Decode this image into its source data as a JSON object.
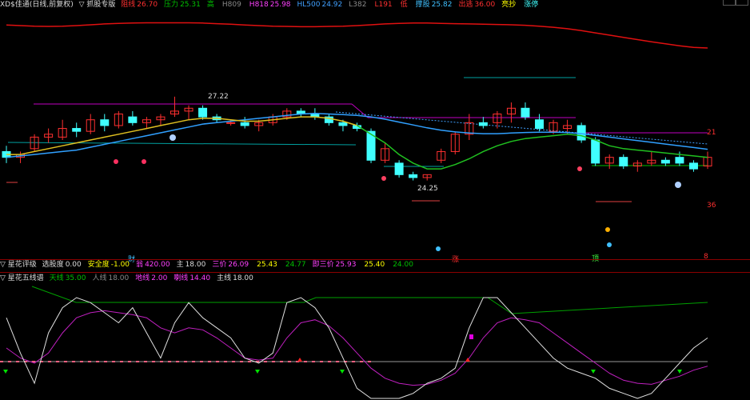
{
  "header": {
    "title": "XD$佳通(日线,前复权)",
    "indicator": "▽ 抓股专版",
    "items": [
      {
        "label": "阻线",
        "value": "26.70",
        "color": "#ff3030"
      },
      {
        "label": "压力",
        "value": "25.31",
        "color": "#00c000"
      },
      {
        "label": "高",
        "value": "",
        "color": "#00c000"
      },
      {
        "label": "H809",
        "value": "",
        "color": "#888"
      },
      {
        "label": "H818",
        "value": "25.98",
        "color": "#ff40ff"
      },
      {
        "label": "HL500",
        "value": "24.92",
        "color": "#40a0ff"
      },
      {
        "label": "L382",
        "value": "",
        "color": "#888"
      },
      {
        "label": "L191",
        "value": "",
        "color": "#ff3030"
      },
      {
        "label": "低",
        "value": "",
        "color": "#ff3030"
      },
      {
        "label": "撑股",
        "value": "25.82",
        "color": "#40c0ff"
      },
      {
        "label": "出逃",
        "value": "36.00",
        "color": "#ff3030"
      },
      {
        "label": "亮抄",
        "value": "",
        "color": "#ffff00"
      },
      {
        "label": "涨停",
        "value": "",
        "color": "#40ffff"
      }
    ]
  },
  "annotations": {
    "high": "27.22",
    "low": "24.25",
    "label_21": "21",
    "label_36": "36",
    "label_8": "8",
    "marker_cai": "财",
    "marker_zhang": "涨",
    "marker_ding": "顶"
  },
  "panel2": {
    "title": "▽ 星花评级",
    "items": [
      {
        "label": "选股度",
        "value": "0.00",
        "color": "#ddd"
      },
      {
        "label": "安全度",
        "value": "-1.00",
        "color": "#ffff00"
      },
      {
        "label": "翁",
        "value": "420.00",
        "color": "#ff40ff"
      },
      {
        "label": "主",
        "value": "18.00",
        "color": "#ddd"
      },
      {
        "label": "三价",
        "value": "26.09",
        "color": "#ff40ff"
      },
      {
        "label": "",
        "value": "25.43",
        "color": "#ffff00"
      },
      {
        "label": "",
        "value": "24.77",
        "color": "#00c000"
      },
      {
        "label": "即三价",
        "value": "25.93",
        "color": "#ff40ff"
      },
      {
        "label": "",
        "value": "25.40",
        "color": "#ffff00"
      },
      {
        "label": "",
        "value": "24.00",
        "color": "#00c000"
      }
    ]
  },
  "panel3": {
    "title": "▽ 星花五线谱",
    "items": [
      {
        "label": "天线",
        "value": "35.00",
        "color": "#00c000"
      },
      {
        "label": "人线",
        "value": "18.00",
        "color": "#888"
      },
      {
        "label": "地线",
        "value": "2.00",
        "color": "#ff40ff"
      },
      {
        "label": "喇线",
        "value": "14.40",
        "color": "#ff40ff"
      },
      {
        "label": "主线",
        "value": "18.00",
        "color": "#ddd"
      }
    ]
  },
  "chart_data": {
    "type": "candlestick",
    "candles": [
      [
        25.3,
        25.5,
        24.9,
        25.1
      ],
      [
        25.1,
        25.3,
        24.9,
        25.2
      ],
      [
        25.4,
        25.9,
        25.3,
        25.8
      ],
      [
        25.8,
        26.1,
        25.6,
        25.9
      ],
      [
        25.8,
        26.4,
        25.7,
        26.1
      ],
      [
        26.1,
        26.3,
        25.8,
        26.0
      ],
      [
        26.0,
        26.6,
        25.9,
        26.4
      ],
      [
        26.4,
        26.6,
        26.0,
        26.2
      ],
      [
        26.2,
        26.7,
        26.1,
        26.6
      ],
      [
        26.5,
        26.7,
        26.2,
        26.3
      ],
      [
        26.3,
        26.5,
        26.1,
        26.4
      ],
      [
        26.4,
        26.6,
        26.2,
        26.5
      ],
      [
        26.6,
        27.2,
        26.5,
        26.7
      ],
      [
        26.7,
        26.9,
        26.4,
        26.8
      ],
      [
        26.8,
        26.9,
        26.4,
        26.5
      ],
      [
        26.5,
        26.6,
        26.3,
        26.4
      ],
      [
        26.3,
        26.4,
        26.2,
        26.3
      ],
      [
        26.3,
        26.5,
        26.1,
        26.2
      ],
      [
        26.2,
        26.4,
        26.0,
        26.3
      ],
      [
        26.3,
        26.6,
        26.2,
        26.5
      ],
      [
        26.5,
        26.8,
        26.4,
        26.7
      ],
      [
        26.7,
        26.8,
        26.5,
        26.6
      ],
      [
        26.6,
        26.8,
        26.4,
        26.5
      ],
      [
        26.5,
        26.6,
        26.2,
        26.3
      ],
      [
        26.3,
        26.4,
        26.0,
        26.2
      ],
      [
        26.2,
        26.3,
        26.0,
        26.1
      ],
      [
        26.0,
        26.1,
        24.9,
        25.0
      ],
      [
        25.0,
        25.6,
        24.9,
        25.4
      ],
      [
        24.9,
        25.0,
        24.4,
        24.5
      ],
      [
        24.5,
        24.6,
        24.3,
        24.4
      ],
      [
        24.4,
        24.5,
        24.3,
        24.5
      ],
      [
        25.0,
        25.4,
        24.9,
        25.3
      ],
      [
        25.3,
        26.0,
        25.2,
        25.9
      ],
      [
        25.9,
        26.6,
        25.7,
        26.3
      ],
      [
        26.3,
        26.5,
        26.1,
        26.2
      ],
      [
        26.3,
        26.7,
        26.1,
        26.6
      ],
      [
        26.6,
        27.0,
        26.3,
        26.8
      ],
      [
        26.8,
        27.0,
        26.4,
        26.5
      ],
      [
        26.4,
        26.6,
        26.0,
        26.1
      ],
      [
        26.0,
        26.4,
        25.9,
        26.3
      ],
      [
        26.1,
        26.4,
        25.9,
        26.2
      ],
      [
        26.2,
        26.3,
        25.6,
        25.7
      ],
      [
        25.7,
        25.8,
        24.8,
        24.9
      ],
      [
        24.9,
        25.2,
        24.7,
        25.1
      ],
      [
        25.1,
        25.2,
        24.7,
        24.8
      ],
      [
        24.8,
        25.0,
        24.6,
        24.9
      ],
      [
        24.9,
        25.3,
        24.8,
        25.0
      ],
      [
        25.0,
        25.1,
        24.8,
        24.9
      ],
      [
        25.1,
        25.3,
        24.8,
        24.9
      ],
      [
        24.9,
        25.0,
        24.6,
        24.7
      ],
      [
        24.8,
        25.3,
        24.7,
        25.1
      ]
    ],
    "ma_short": [
      25.2,
      25.2,
      25.3,
      25.4,
      25.5,
      25.6,
      25.7,
      25.8,
      25.9,
      26.0,
      26.1,
      26.2,
      26.3,
      26.4,
      26.45,
      26.45,
      26.4,
      26.35,
      26.35,
      26.4,
      26.45,
      26.5,
      26.5,
      26.45,
      26.35,
      26.2,
      25.9,
      25.6,
      25.2,
      24.9,
      24.7,
      24.7,
      24.85,
      25.05,
      25.3,
      25.5,
      25.65,
      25.75,
      25.8,
      25.85,
      25.9,
      25.85,
      25.7,
      25.5,
      25.4,
      25.35,
      25.3,
      25.25,
      25.2,
      25.15,
      25.1
    ],
    "ma_long": [
      25.1,
      25.15,
      25.2,
      25.25,
      25.3,
      25.35,
      25.45,
      25.55,
      25.65,
      25.75,
      25.85,
      25.95,
      26.05,
      26.15,
      26.25,
      26.3,
      26.35,
      26.4,
      26.45,
      26.5,
      26.55,
      26.6,
      26.62,
      26.6,
      26.58,
      26.55,
      26.5,
      26.42,
      26.32,
      26.22,
      26.12,
      26.04,
      25.98,
      25.94,
      25.92,
      25.92,
      25.94,
      25.96,
      25.97,
      25.97,
      25.96,
      25.92,
      25.86,
      25.8,
      25.74,
      25.68,
      25.62,
      25.56,
      25.5,
      25.44,
      25.38
    ],
    "top_curve": [
      0.82,
      0.8,
      0.78,
      0.77,
      0.78,
      0.8,
      0.83,
      0.86,
      0.88,
      0.89,
      0.9,
      0.9,
      0.9,
      0.9,
      0.89,
      0.87,
      0.85,
      0.82,
      0.8,
      0.78,
      0.77,
      0.76,
      0.76,
      0.77,
      0.78,
      0.8,
      0.83,
      0.86,
      0.88,
      0.89,
      0.89,
      0.88,
      0.87,
      0.86,
      0.85,
      0.84,
      0.83,
      0.81,
      0.78,
      0.74,
      0.69,
      0.62,
      0.54,
      0.46,
      0.38,
      0.3,
      0.22,
      0.15,
      0.08,
      0.02,
      0.0
    ],
    "oscillator_white": [
      80,
      45,
      15,
      65,
      90,
      100,
      95,
      85,
      75,
      90,
      65,
      40,
      75,
      95,
      80,
      70,
      60,
      40,
      35,
      45,
      95,
      100,
      90,
      70,
      40,
      10,
      0,
      0,
      0,
      5,
      15,
      20,
      30,
      70,
      100,
      100,
      85,
      70,
      55,
      40,
      30,
      25,
      20,
      10,
      5,
      0,
      5,
      20,
      35,
      50,
      60
    ],
    "oscillator_purple": [
      50,
      40,
      35,
      45,
      65,
      80,
      85,
      87,
      85,
      83,
      80,
      70,
      65,
      70,
      68,
      60,
      50,
      40,
      38,
      40,
      60,
      75,
      78,
      72,
      60,
      45,
      30,
      20,
      15,
      13,
      14,
      18,
      25,
      40,
      60,
      75,
      80,
      78,
      75,
      65,
      55,
      45,
      35,
      25,
      18,
      15,
      14,
      18,
      22,
      28,
      32
    ]
  }
}
